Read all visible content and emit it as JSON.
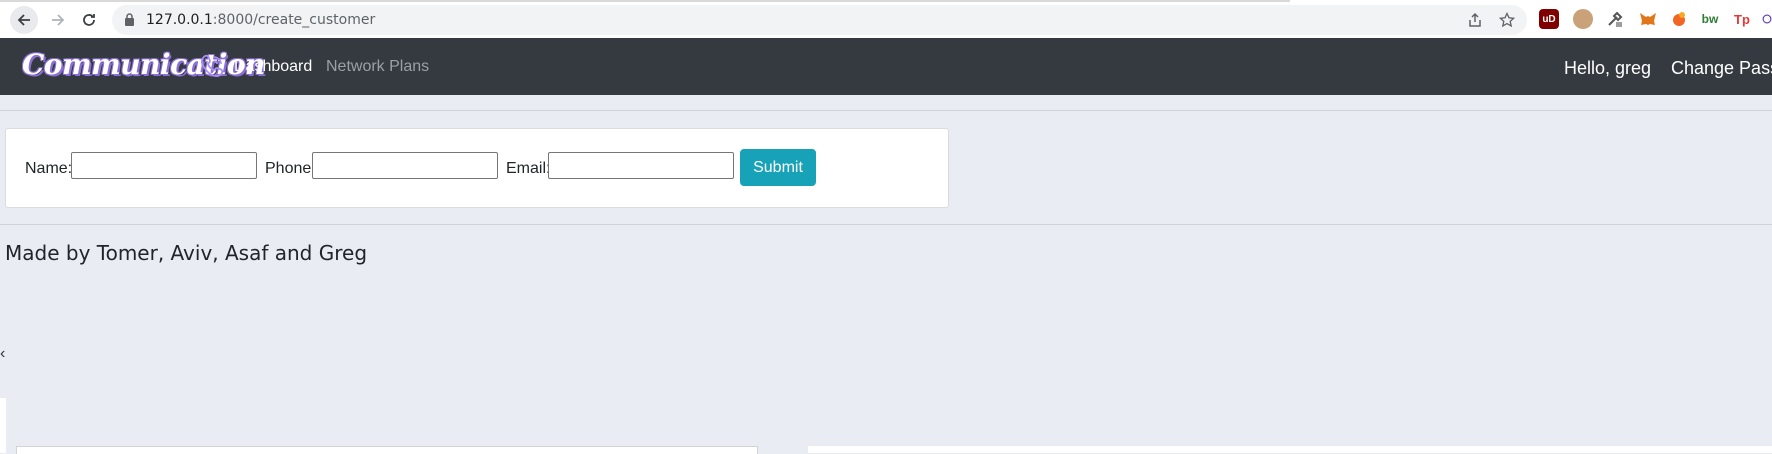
{
  "browser": {
    "url_host": "127.0.0.1",
    "url_path": ":8000/create_customer",
    "extensions": [
      {
        "name": "ublock-origin",
        "label": "uD",
        "color": "#800000"
      },
      {
        "name": "face-extension",
        "label": "",
        "color": "#c9a27a"
      },
      {
        "name": "eyedropper",
        "label": "",
        "color": "#7a7a7a"
      },
      {
        "name": "metamask",
        "label": "",
        "color": "#e2761b"
      },
      {
        "name": "orange-extension",
        "label": "",
        "color": "#f26522"
      },
      {
        "name": "bw-extension",
        "label": "bw",
        "color": "#2e7d32"
      },
      {
        "name": "tp-extension",
        "label": "Tp",
        "color": "#e53935"
      },
      {
        "name": "purple-extension",
        "label": "",
        "color": "#5e35b1"
      }
    ]
  },
  "navbar": {
    "brand": "Communication",
    "links": [
      {
        "label": "Dashboard",
        "active": true
      },
      {
        "label": "Network Plans",
        "active": false
      }
    ],
    "greeting": "Hello, greg",
    "change_password": "Change Pass"
  },
  "form": {
    "name_label": "Name:",
    "phone_label": "Phone:",
    "email_label": "Email:",
    "name_value": "",
    "phone_value": "",
    "email_value": "",
    "submit_label": "Submit"
  },
  "footer": {
    "credit": "Made by Tomer, Aviv, Asaf and Greg"
  },
  "colors": {
    "navbar": "#343a40",
    "page_bg": "#e9ecf3",
    "submit": "#17a2b8",
    "brand_outline": "#8b6fd6"
  }
}
